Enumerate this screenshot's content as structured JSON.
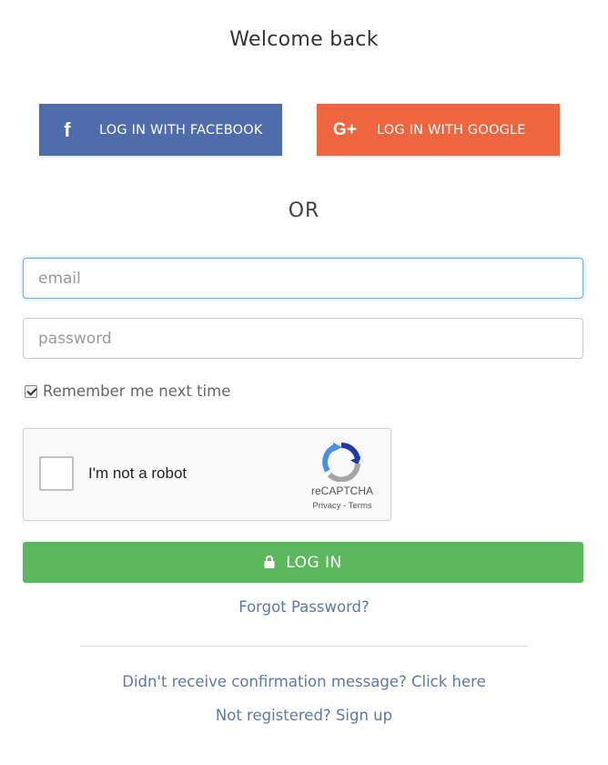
{
  "title": "Welcome back",
  "social": {
    "facebook_label": "LOG IN WITH FACEBOOK",
    "facebook_icon": "f",
    "facebook_color": "#4e6daa",
    "google_label": "LOG IN WITH GOOGLE",
    "google_icon": "G+",
    "google_color": "#ee6640"
  },
  "separator": "OR",
  "form": {
    "email_placeholder": "email",
    "email_value": "",
    "password_placeholder": "password",
    "password_value": "",
    "remember_label": "Remember me next time",
    "remember_checked": true
  },
  "captcha": {
    "label": "I'm not a robot",
    "brand": "reCAPTCHA",
    "links": "Privacy - Terms"
  },
  "login_button": {
    "label": "LOG IN",
    "color": "#5cb85c"
  },
  "links": {
    "forgot": "Forgot Password?",
    "confirm": "Didn't receive confirmation message? Click here",
    "signup": "Not registered? Sign up"
  }
}
